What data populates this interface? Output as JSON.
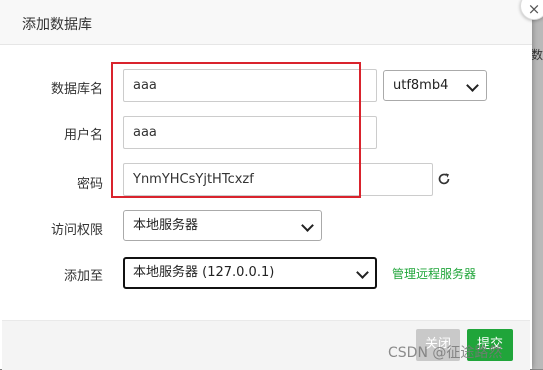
{
  "dialog": {
    "title": "添加数据库"
  },
  "form": {
    "db_name": {
      "label": "数据库名",
      "value": "aaa",
      "charset": "utf8mb4"
    },
    "username": {
      "label": "用户名",
      "value": "aaa"
    },
    "password": {
      "label": "密码",
      "value": "YnmYHCsYjtHTcxzf"
    },
    "access": {
      "label": "访问权限",
      "value": "本地服务器"
    },
    "add_to": {
      "label": "添加至",
      "value": "本地服务器 (127.0.0.1)",
      "link": "管理远程服务器"
    }
  },
  "footer": {
    "cancel_label": "关闭",
    "submit_label": "提交"
  },
  "watermark": "CSDN @征途路然",
  "background": {
    "peek_text": "数"
  },
  "icons": {
    "close": "close-icon",
    "refresh": "refresh-icon",
    "dropdown": "chevron-down-icon"
  },
  "colors": {
    "accent": "#20a53a",
    "highlight": "#d9232d"
  }
}
